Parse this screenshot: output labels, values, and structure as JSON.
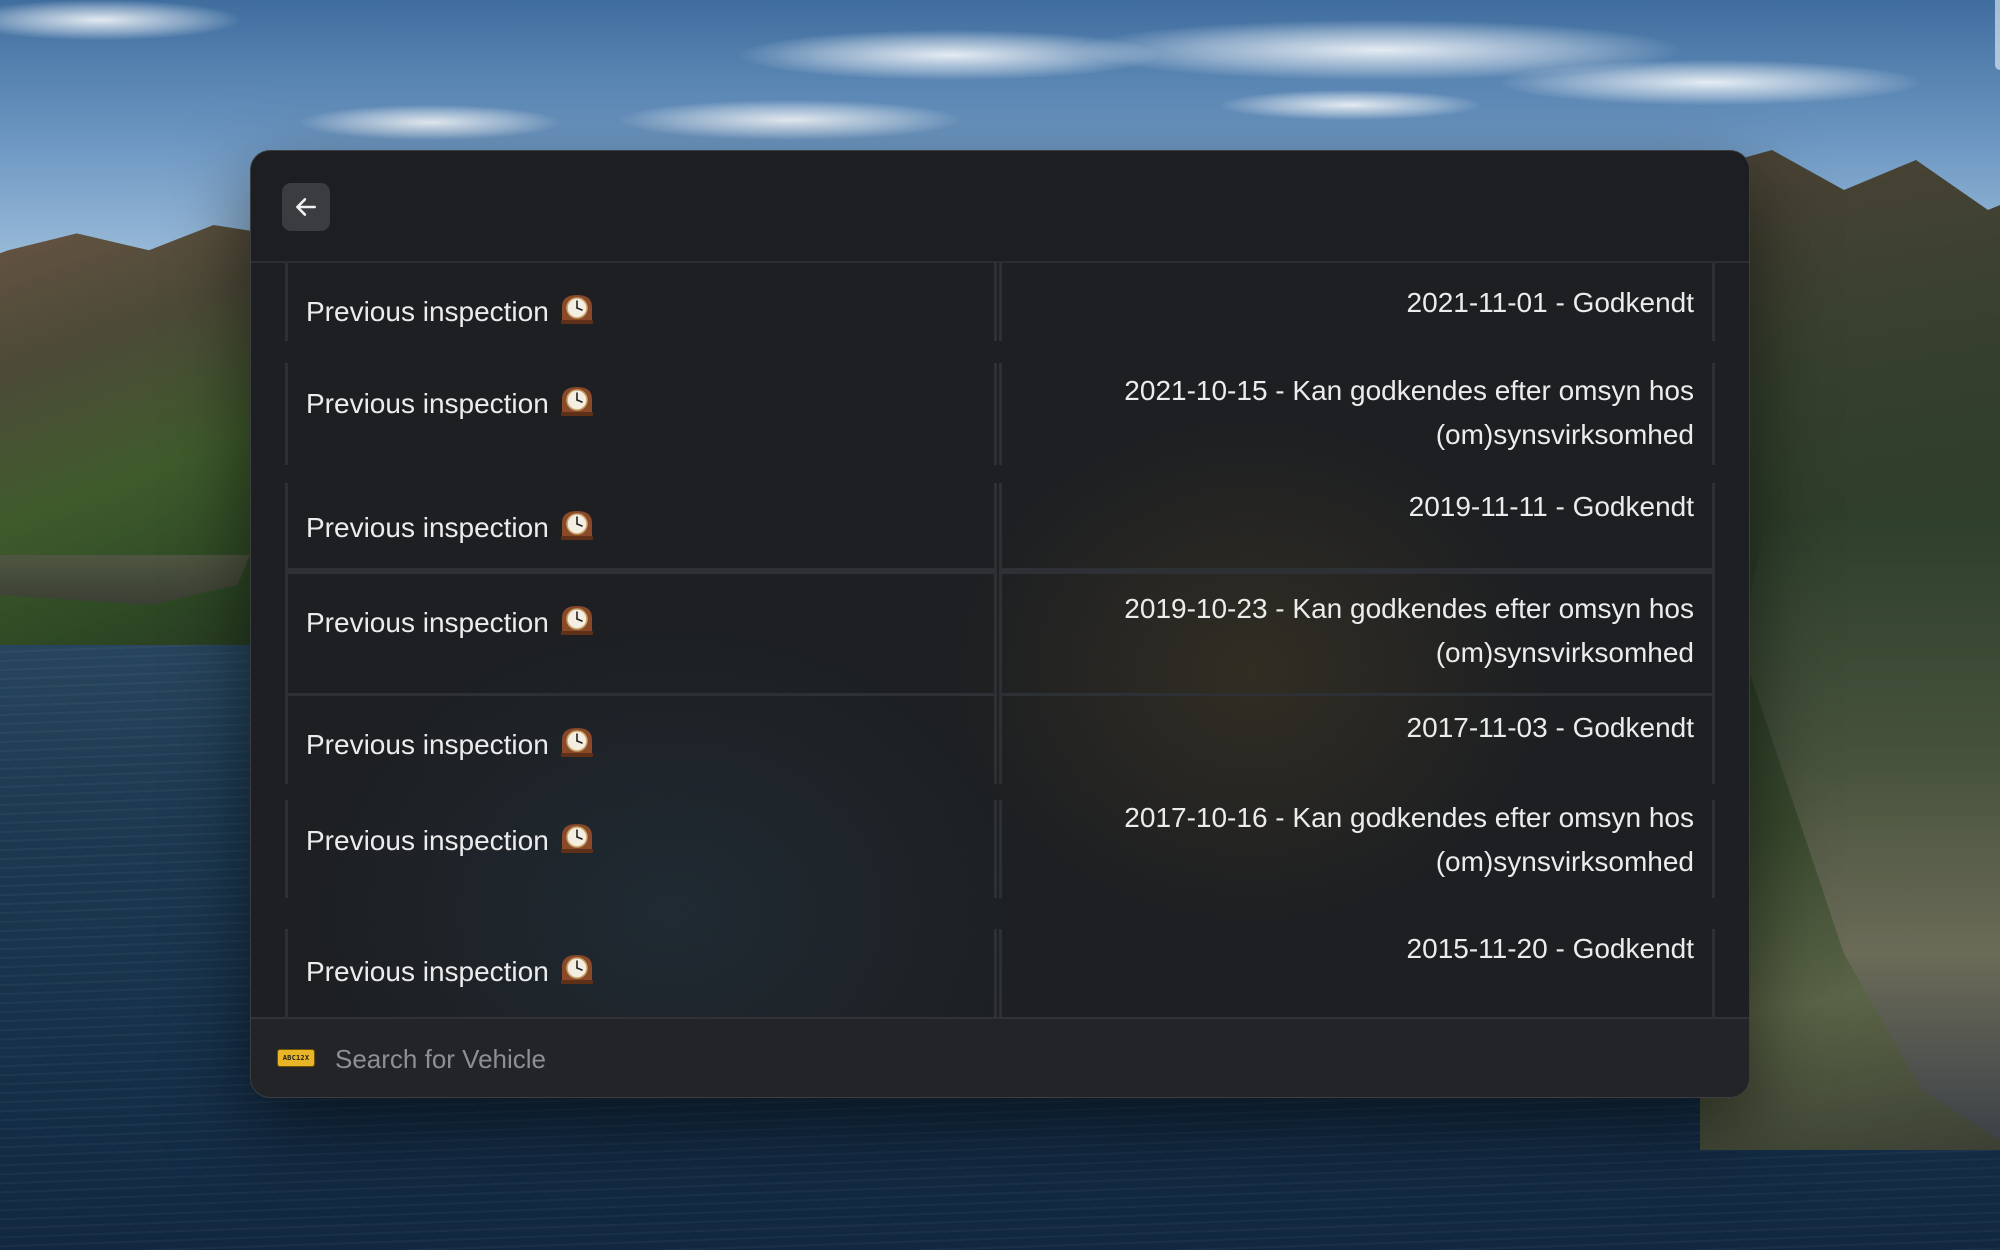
{
  "window": {
    "back_button_label": "Back",
    "icons": {
      "back": "arrow-left-icon",
      "clock": "mantelpiece-clock-icon",
      "plate": "license-plate-icon"
    }
  },
  "inspections": [
    {
      "label": "Previous inspection",
      "value": "2021-11-01 - Godkendt"
    },
    {
      "label": "Previous inspection",
      "value": "2021-10-15 - Kan godkendes efter omsyn hos (om)synsvirksomhed"
    },
    {
      "label": "Previous inspection",
      "value": "2019-11-11 - Godkendt"
    },
    {
      "label": "Previous inspection",
      "value": "2019-10-23 - Kan godkendes efter omsyn hos (om)synsvirksomhed"
    },
    {
      "label": "Previous inspection",
      "value": "2017-11-03 - Godkendt"
    },
    {
      "label": "Previous inspection",
      "value": "2017-10-16 - Kan godkendes efter omsyn hos (om)synsvirksomhed"
    },
    {
      "label": "Previous inspection",
      "value": "2015-11-20 - Godkendt"
    }
  ],
  "search": {
    "placeholder": "Search for Vehicle",
    "value": "",
    "plate_text": "ABC12X"
  },
  "colors": {
    "window_bg": "#1d1f22",
    "text": "#ececec",
    "placeholder": "#8d8f93",
    "plate": "#e7b526",
    "divider": "#2d3035"
  }
}
